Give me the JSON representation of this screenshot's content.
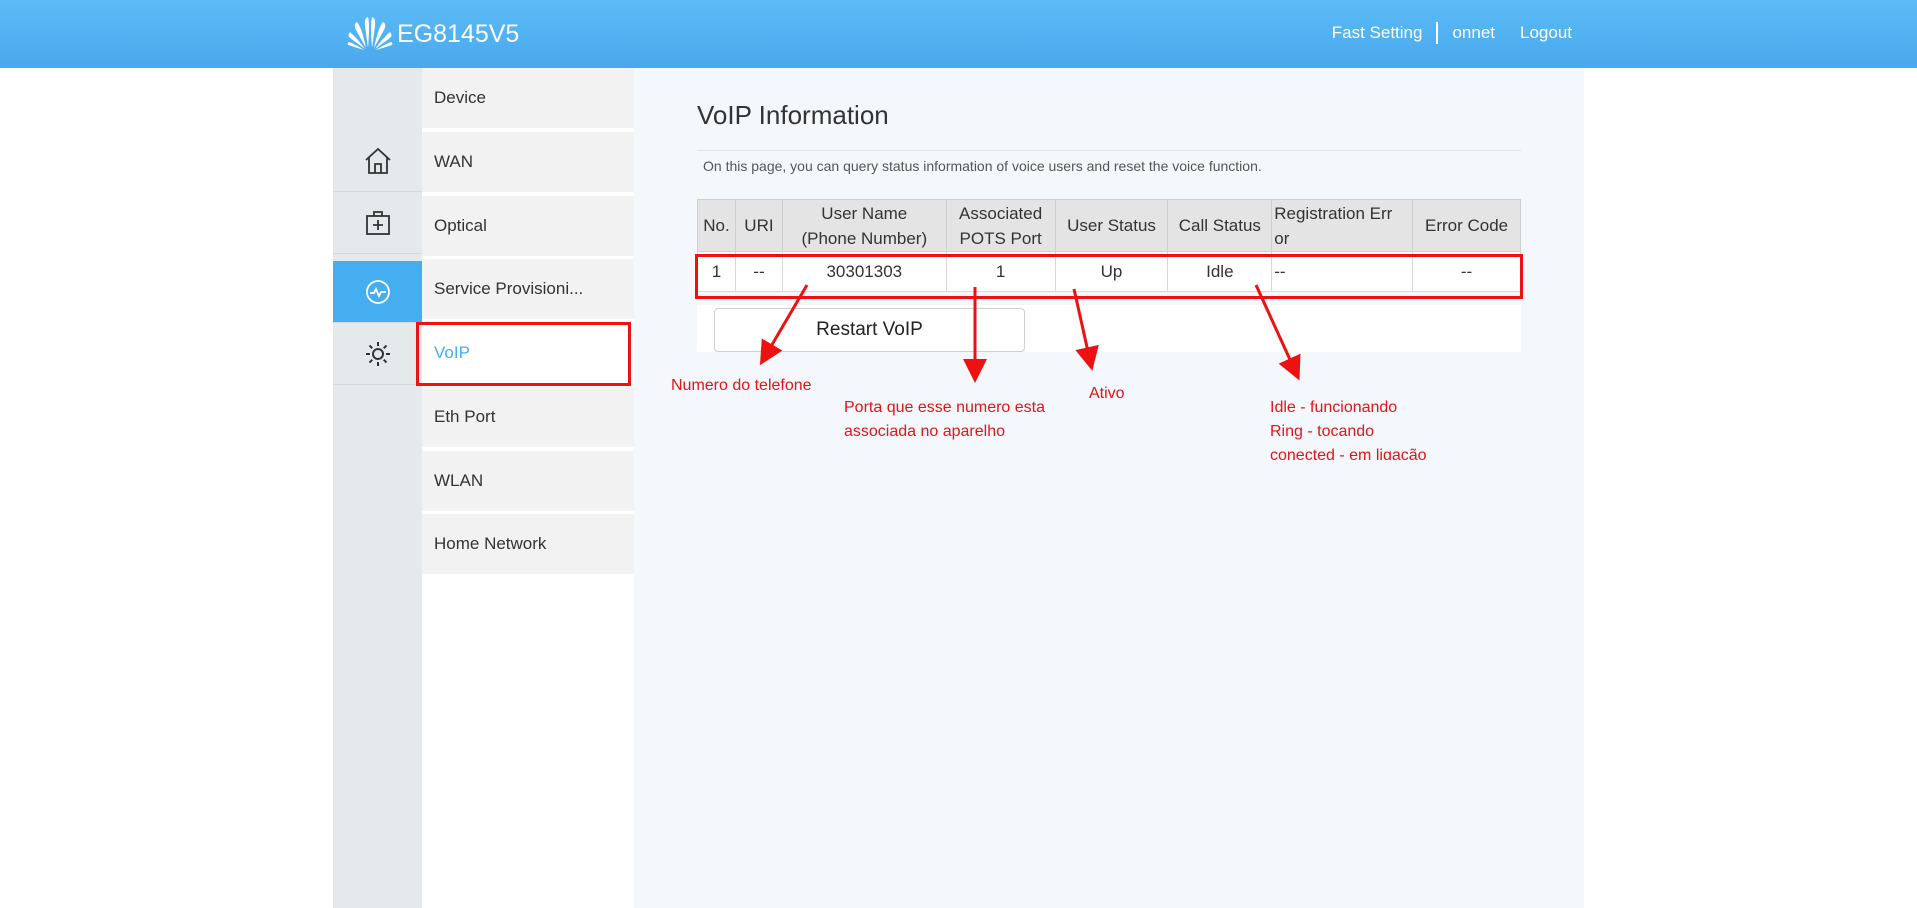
{
  "header": {
    "brand_color": "#4aa8ec",
    "product_name": "EG8145V5",
    "logo_icon": "huawei-logo",
    "links": {
      "fast_setting": "Fast Setting",
      "user": "onnet",
      "logout": "Logout"
    }
  },
  "icon_rail": {
    "items": [
      {
        "icon": "home-icon"
      },
      {
        "icon": "medical-kit-icon"
      },
      {
        "icon": "monitor-pulse-icon",
        "active": true
      },
      {
        "icon": "gear-icon"
      }
    ]
  },
  "menu": {
    "items": [
      {
        "label": "Device"
      },
      {
        "label": "WAN"
      },
      {
        "label": "Optical"
      },
      {
        "label": "Service Provisioni..."
      },
      {
        "label": "VoIP",
        "active": true
      },
      {
        "label": "Eth Port"
      },
      {
        "label": "WLAN"
      },
      {
        "label": "Home Network"
      }
    ]
  },
  "main": {
    "title": "VoIP Information",
    "description": "On this page, you can query status information of voice users and reset the voice function.",
    "table": {
      "headers": {
        "no": "No.",
        "uri": "URI",
        "user_name_1": "User Name",
        "user_name_2": "(Phone Number)",
        "pots_1": "Associated",
        "pots_2": "POTS Port",
        "user_status": "User Status",
        "call_status": "Call Status",
        "reg_error_1": "Registration Err",
        "reg_error_2": "or",
        "error_code": "Error Code"
      },
      "rows": [
        {
          "no": "1",
          "uri": "--",
          "user_name": "30301303",
          "pots_port": "1",
          "user_status": "Up",
          "call_status": "Idle",
          "registration_error": "--",
          "error_code": "--"
        }
      ]
    },
    "restart_button": "Restart VoIP"
  },
  "annotations": {
    "color": "#e31515",
    "phone": "Numero do telefone",
    "port_1": "Porta que esse numero esta",
    "port_2": "associada no aparelho",
    "active": "Ativo",
    "call_1": "Idle - funcionando",
    "call_2": "Ring - tocando",
    "call_3": "conected - em ligação"
  }
}
